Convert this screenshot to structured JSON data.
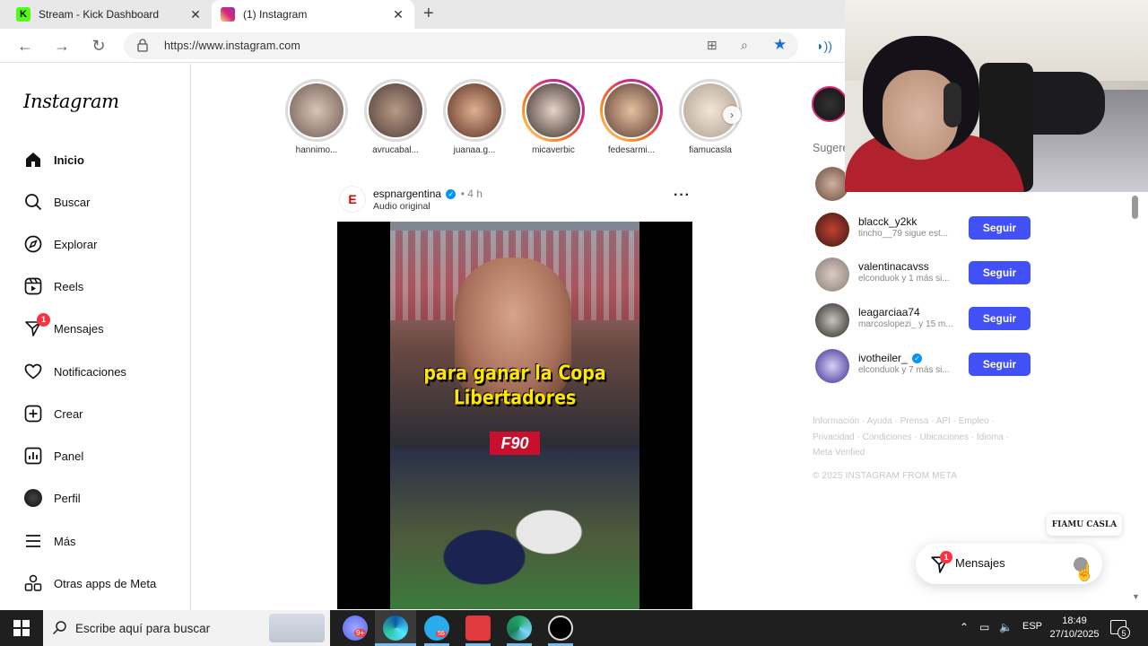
{
  "browser": {
    "tabs": [
      {
        "title": "Stream - Kick Dashboard",
        "favicon_color": "#53fc18"
      },
      {
        "title": "(1) Instagram",
        "favicon_color": "#d62976"
      }
    ],
    "url": "https://www.instagram.com"
  },
  "sidebar": {
    "logo": "Instagram",
    "items": [
      {
        "label": "Inicio",
        "icon": "home-icon"
      },
      {
        "label": "Buscar",
        "icon": "search-icon"
      },
      {
        "label": "Explorar",
        "icon": "compass-icon"
      },
      {
        "label": "Reels",
        "icon": "reels-icon"
      },
      {
        "label": "Mensajes",
        "icon": "messenger-icon",
        "badge": "1"
      },
      {
        "label": "Notificaciones",
        "icon": "heart-icon"
      },
      {
        "label": "Crear",
        "icon": "plus-square-icon"
      },
      {
        "label": "Panel",
        "icon": "chart-icon"
      },
      {
        "label": "Perfil",
        "icon": "profile-avatar-icon"
      },
      {
        "label": "Más",
        "icon": "menu-icon"
      },
      {
        "label": "Otras apps de Meta",
        "icon": "meta-apps-icon"
      }
    ]
  },
  "stories": [
    {
      "username": "hannimo...",
      "seen": true,
      "color": "#b7a39a"
    },
    {
      "username": "avrucabal...",
      "seen": true,
      "color": "#8d6e60"
    },
    {
      "username": "juanaa.g...",
      "seen": true,
      "color": "#c98e74"
    },
    {
      "username": "micaverbic",
      "seen": false,
      "color": "#a08070"
    },
    {
      "username": "fedesarmi...",
      "seen": false,
      "color": "#c09a7c"
    },
    {
      "username": "fiamucasla",
      "seen": true,
      "color": "#e6d2b8"
    }
  ],
  "post": {
    "username": "espnargentina",
    "time": "• 4 h",
    "audio": "Audio original",
    "caption_line1": "para ganar la Copa",
    "caption_line2": "Libertadores",
    "channel_logo": "F90"
  },
  "suggestions": {
    "title": "Sugere",
    "follow_label": "Seguir",
    "users": [
      {
        "name": "blacck_y2kk",
        "sub": "tincho__79 sigue est...",
        "color": "#6b3a2a",
        "verified": false
      },
      {
        "name": "valentinacavss",
        "sub": "elconduok y 1 más si...",
        "color": "#a89a90",
        "verified": false
      },
      {
        "name": "leagarciaa74",
        "sub": "marcoslopezi_ y 15 m...",
        "color": "#3a3836",
        "verified": false
      },
      {
        "name": "ivotheiler_",
        "sub": "elconduok y 7 más si...",
        "color": "#4a3aa8",
        "verified": true
      }
    ]
  },
  "footer": {
    "links": [
      "Información",
      "Ayuda",
      "Prensa",
      "API",
      "Empleo",
      "Privacidad",
      "Condiciones",
      "Ubicaciones",
      "Idioma",
      "Meta Verified"
    ],
    "copyright": "© 2025 INSTAGRAM FROM META"
  },
  "messages_widget": {
    "label": "Mensajes",
    "badge": "1",
    "tooltip": "FIAMU CASLA"
  },
  "taskbar": {
    "search_placeholder": "Escribe aquí para buscar",
    "language": "ESP",
    "time": "18:49",
    "date": "27/10/2025",
    "notifications": "5",
    "discord_badge": "9+",
    "telegram_badge": "55"
  }
}
